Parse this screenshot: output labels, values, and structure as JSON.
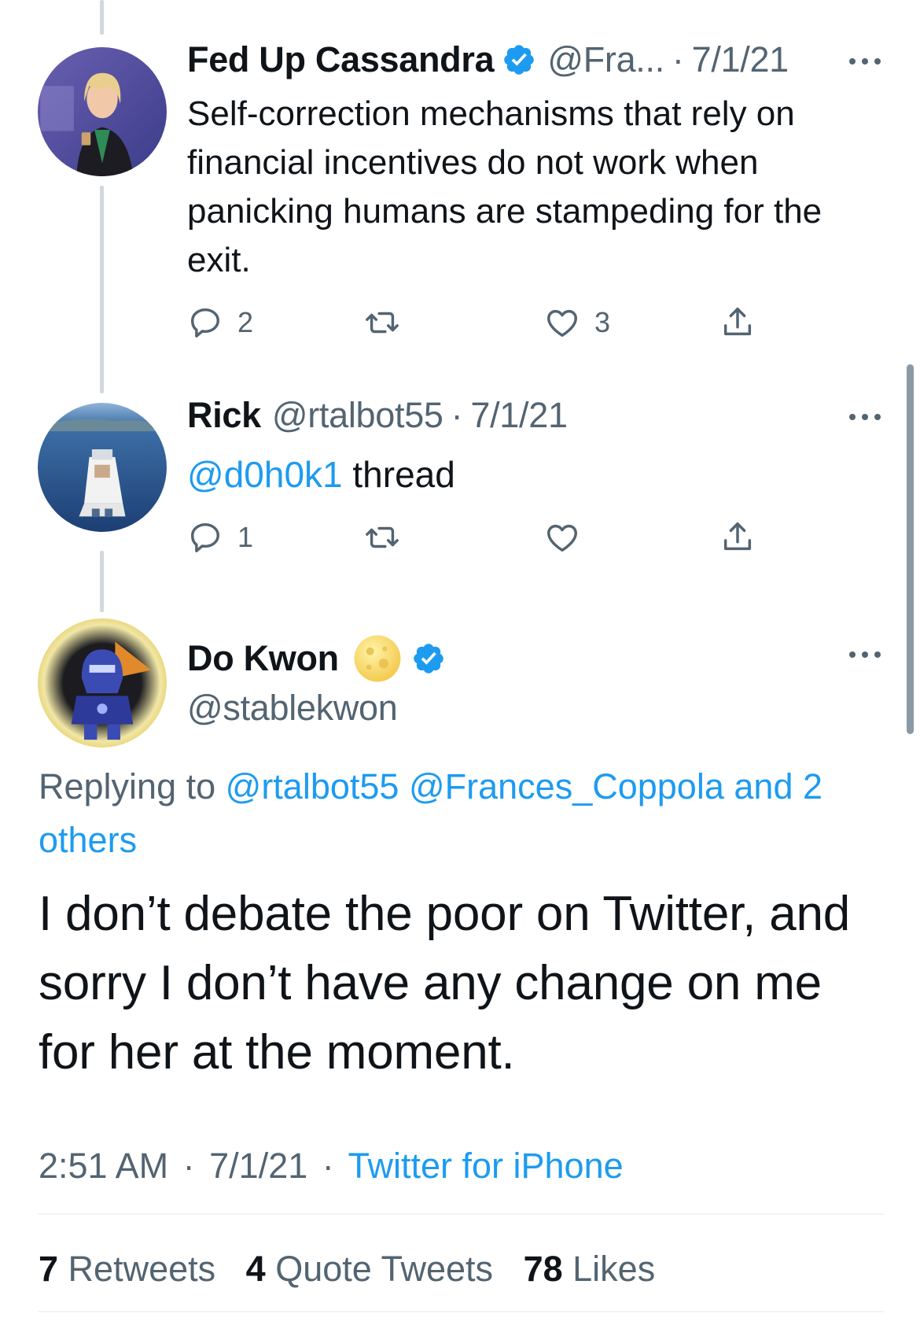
{
  "tweets": [
    {
      "name": "Fed Up Cassandra",
      "handle": "@Fra...",
      "sep": "·",
      "date": "7/1/21",
      "verified": true,
      "text": "Self-correction mechanisms that rely on financial incentives do not work when panicking humans are stampeding for the exit.",
      "replies": "2",
      "retweets": "",
      "likes": "3"
    },
    {
      "name": "Rick",
      "handle": "@rtalbot55",
      "sep": "·",
      "date": "7/1/21",
      "mention": "@d0h0k1",
      "text": " thread",
      "replies": "1",
      "retweets": "",
      "likes": ""
    }
  ],
  "main_tweet": {
    "name": "Do Kwon",
    "handle": "@stablekwon",
    "replying_prefix": "Replying to ",
    "reply_handle_1": "@rtalbot55",
    "reply_handle_2": "@Frances_Coppola",
    "reply_others": "and 2 others",
    "text": "I don’t debate the poor on Twitter, and sorry I don’t have any change on me for her at the moment.",
    "time": "2:51 AM",
    "date": "7/1/21",
    "sep": "·",
    "source": "Twitter for iPhone",
    "retweets_count": "7",
    "retweets_label": "Retweets",
    "quotes_count": "4",
    "quotes_label": "Quote Tweets",
    "likes_count": "78",
    "likes_label": "Likes"
  },
  "colors": {
    "accent": "#1d9bf0",
    "muted": "#536471",
    "text": "#0f1419",
    "thread_line": "#cfd9de"
  },
  "icons": [
    "verified-badge-icon",
    "more-icon",
    "reply-icon",
    "retweet-icon",
    "like-icon",
    "share-icon",
    "moon-emoji"
  ]
}
